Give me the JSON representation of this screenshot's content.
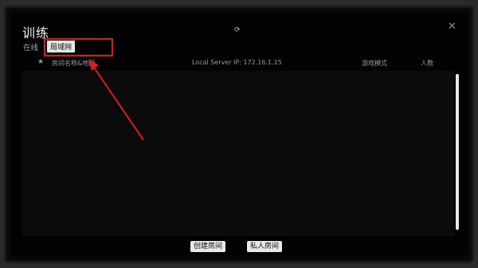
{
  "window": {
    "title": "训练",
    "refresh_icon": "⟳",
    "close_icon": "✕"
  },
  "tabs": {
    "online": "在线",
    "lan": "局域网",
    "selected": "lan"
  },
  "table": {
    "star_icon": "★",
    "col_room": "房间名称&地图",
    "server_ip": "Local Server IP: 172.16.1.15",
    "col_mode": "游戏模式",
    "col_players": "人数"
  },
  "buttons": {
    "create_room": "创建房间",
    "private_room": "私人房间"
  },
  "annotation": {
    "color": "#d81b1b"
  }
}
